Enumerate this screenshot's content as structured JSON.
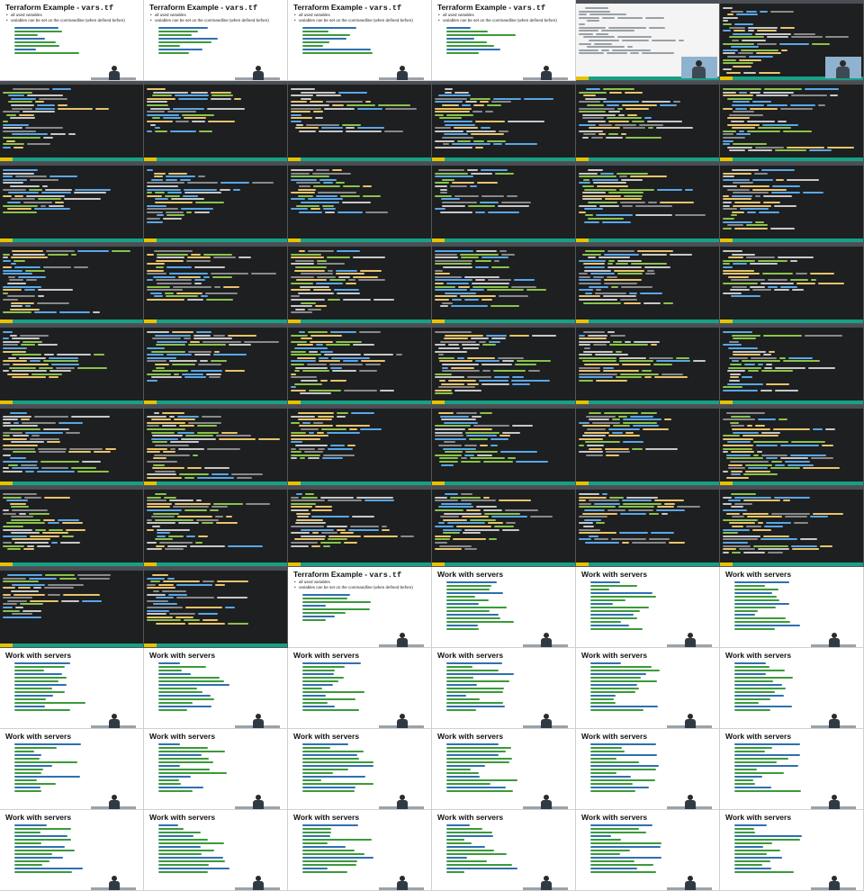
{
  "contact_sheet": {
    "columns": 6,
    "rows": 11,
    "colors": {
      "terminal_bg": "#1d1f21",
      "status_bar": "#16a085",
      "mode_indicator": "#e6c300",
      "syntax_keyword": "#5aa7e6",
      "syntax_string": "#e9c46a",
      "syntax_green": "#8bc34a",
      "syntax_text": "#c8c8c8",
      "syntax_comment": "#8a8a8a",
      "slide_code_green": "#3a9a3a",
      "slide_code_blue": "#2f6fb0"
    }
  },
  "slides": {
    "vars_tf": {
      "title_prefix": "Terraform Example - ",
      "title_code": "vars.tf",
      "bullets": [
        "all used variables",
        "variables can be set on the commandline (when defined before)"
      ]
    },
    "work_with_servers": {
      "title": "Work with servers"
    }
  },
  "frames": [
    "slide-vars",
    "slide-vars",
    "slide-vars",
    "slide-vars",
    "term-light",
    "term-webcam",
    "term",
    "term",
    "term",
    "term",
    "term",
    "term",
    "term",
    "term",
    "term",
    "term",
    "term",
    "term",
    "term",
    "term",
    "term",
    "term",
    "term",
    "term",
    "term",
    "term",
    "term",
    "term",
    "term",
    "term",
    "term",
    "term",
    "term",
    "term",
    "term",
    "term",
    "term",
    "term",
    "term",
    "term",
    "term",
    "term",
    "term",
    "term",
    "slide-vars",
    "slide-servers",
    "slide-servers",
    "slide-servers",
    "slide-servers",
    "slide-servers",
    "slide-servers",
    "slide-servers",
    "slide-servers",
    "slide-servers",
    "slide-servers",
    "slide-servers",
    "slide-servers",
    "slide-servers",
    "slide-servers",
    "slide-servers",
    "slide-servers",
    "slide-servers",
    "slide-servers",
    "slide-servers",
    "slide-servers",
    "slide-servers"
  ]
}
